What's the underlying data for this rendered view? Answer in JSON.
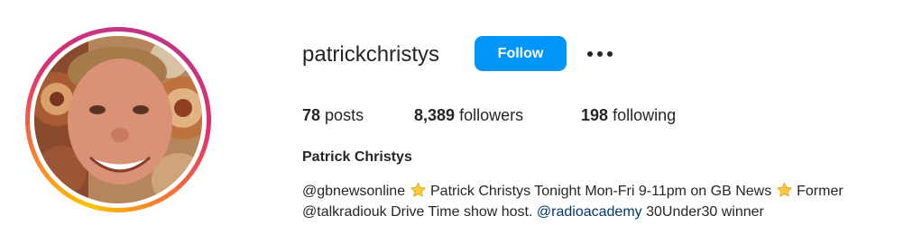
{
  "profile": {
    "username": "patrickchristys",
    "follow_label": "Follow",
    "more_icon": "more-options-icon",
    "avatar_description_icon": "profile-photo"
  },
  "stats": {
    "posts_count": "78",
    "posts_label": "posts",
    "followers_count": "8,389",
    "followers_label": "followers",
    "following_count": "198",
    "following_label": "following"
  },
  "bio": {
    "full_name": "Patrick Christys",
    "line1_part1": "@gbnewsonline",
    "line1_part2": "Patrick Christys Tonight Mon-Fri 9-11pm on GB News",
    "line1_part3": "Former",
    "line2_part1": "@talkradiouk Drive Time show host.",
    "line2_link": "@radioacademy",
    "line2_part2": "30Under30 winner"
  },
  "colors": {
    "follow_button": "#0095f6",
    "text": "#262626",
    "link": "#00376b",
    "ring_start": "#fdc400",
    "ring_end": "#c13584",
    "star": "#ffc83d"
  }
}
